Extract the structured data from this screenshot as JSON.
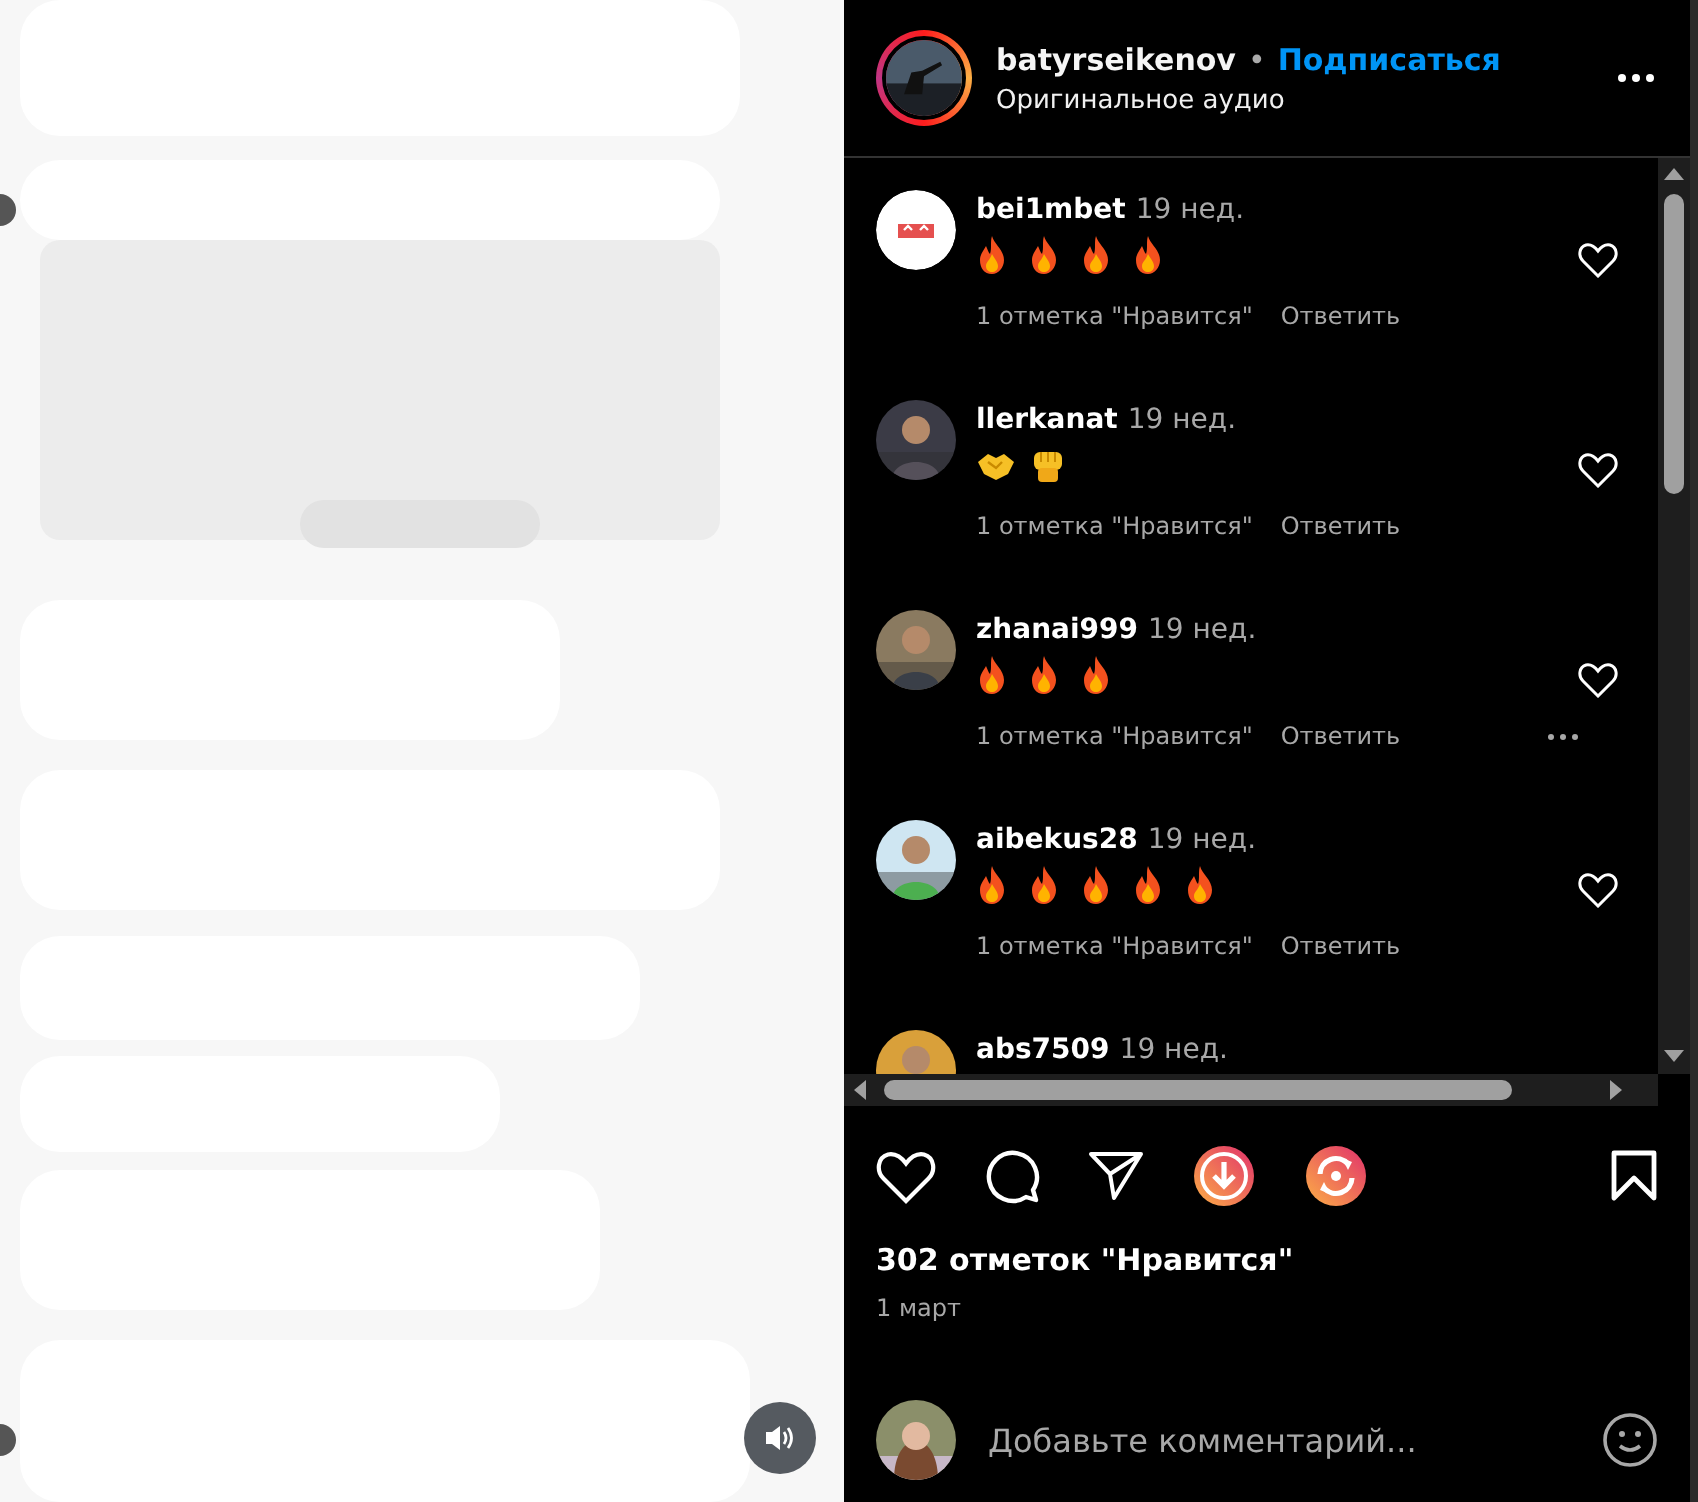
{
  "post_media": {
    "kind": "picture"
  },
  "header": {
    "username": "batyrseikenov",
    "separator": "•",
    "follow": "Подписаться",
    "audio": "Оригинальное аудио"
  },
  "comments": [
    {
      "username": "bei1mbet",
      "time": "19 нед.",
      "avatar": {
        "kind": "logo"
      },
      "emojis": [
        {
          "kind": "fire"
        },
        {
          "kind": "fire"
        },
        {
          "kind": "fire"
        },
        {
          "kind": "fire"
        }
      ],
      "likes": "1 отметка \"Нравится\"",
      "reply": "Ответить",
      "more": false
    },
    {
      "username": "llerkanat",
      "time": "19 нед.",
      "avatar": {
        "kind": "picture"
      },
      "emojis": [
        {
          "kind": "handshake"
        },
        {
          "kind": "fist"
        }
      ],
      "likes": "1 отметка \"Нравится\"",
      "reply": "Ответить",
      "more": false
    },
    {
      "username": "zhanai999",
      "time": "19 нед.",
      "avatar": {
        "kind": "picture"
      },
      "emojis": [
        {
          "kind": "fire"
        },
        {
          "kind": "fire"
        },
        {
          "kind": "fire"
        }
      ],
      "likes": "1 отметка \"Нравится\"",
      "reply": "Ответить",
      "more": true
    },
    {
      "username": "aibekus28",
      "time": "19 нед.",
      "avatar": {
        "kind": "picture"
      },
      "emojis": [
        {
          "kind": "fire"
        },
        {
          "kind": "fire"
        },
        {
          "kind": "fire"
        },
        {
          "kind": "fire"
        },
        {
          "kind": "fire"
        }
      ],
      "likes": "1 отметка \"Нравится\"",
      "reply": "Ответить",
      "more": false
    },
    {
      "username": "abs7509",
      "time": "19 нед.",
      "avatar": {
        "kind": "picture"
      },
      "more": false
    }
  ],
  "likes_total": "302 отметок \"Нравится\"",
  "date": "1 март",
  "comment_input": {
    "placeholder": "Добавьте комментарий..."
  }
}
